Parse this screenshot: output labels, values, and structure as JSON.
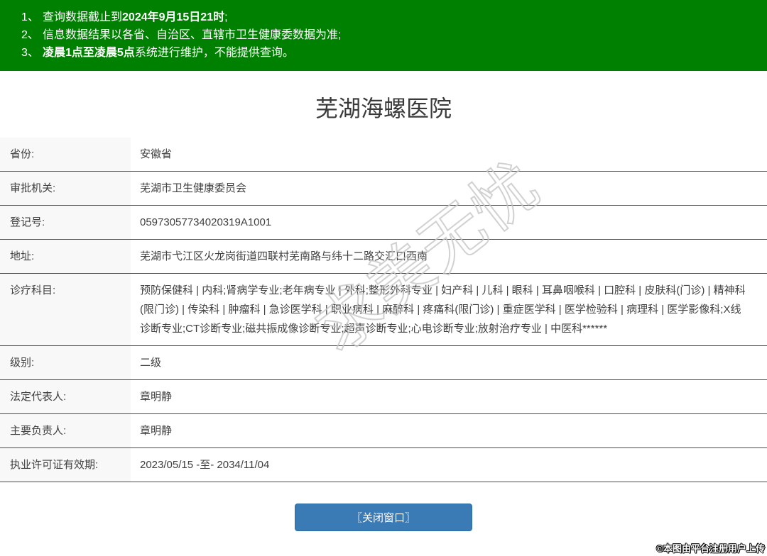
{
  "notice": {
    "items": [
      {
        "num": "1、",
        "segments": [
          {
            "t": "查询数据截止到",
            "b": false
          },
          {
            "t": "2024年9月15日21时",
            "b": true
          },
          {
            "t": ";",
            "b": false
          }
        ]
      },
      {
        "num": "2、",
        "segments": [
          {
            "t": "信息数据结果以各省、自治区、直辖市卫生健康委数据为准;",
            "b": false
          }
        ]
      },
      {
        "num": "3、",
        "segments": [
          {
            "t": "凌晨1点至凌晨5点",
            "b": true
          },
          {
            "t": "系统进行维护，不能提供查询。",
            "b": false
          }
        ]
      }
    ]
  },
  "page": {
    "title": "芜湖海螺医院"
  },
  "details": {
    "rows": [
      {
        "label": "省份:",
        "value": "安徽省"
      },
      {
        "label": "审批机关:",
        "value": "芜湖市卫生健康委员会"
      },
      {
        "label": "登记号:",
        "value": "05973057734020319A1001"
      },
      {
        "label": "地址:",
        "value": "芜湖市弋江区火龙岗街道四联村芜南路与纬十二路交汇口西南"
      },
      {
        "label": "诊疗科目:",
        "value": "预防保健科 | 内科;肾病学专业;老年病专业 | 外科;整形外科专业 | 妇产科 | 儿科 | 眼科 | 耳鼻咽喉科 | 口腔科 | 皮肤科(门诊) | 精神科(限门诊) | 传染科 | 肿瘤科 | 急诊医学科 | 职业病科 | 麻醉科 | 疼痛科(限门诊) | 重症医学科 | 医学检验科 | 病理科 | 医学影像科;X线诊断专业;CT诊断专业;磁共振成像诊断专业;超声诊断专业;心电诊断专业;放射治疗专业 | 中医科******"
      },
      {
        "label": "级别:",
        "value": "二级"
      },
      {
        "label": "法定代表人:",
        "value": "章明静"
      },
      {
        "label": "主要负责人:",
        "value": "章明静"
      },
      {
        "label": "执业许可证有效期:",
        "value": "2023/05/15 -至- 2034/11/04"
      }
    ]
  },
  "watermark": {
    "text": "求美无忧"
  },
  "footer": {
    "close_button": "〖关闭窗口〗",
    "credit": "©本图由平台注册用户上传"
  },
  "colors": {
    "header_bg": "#008000",
    "row_border": "#0c6b3f",
    "label_bg": "#f8f8f8",
    "button_bg": "#3a7ab5",
    "text": "#404040"
  }
}
